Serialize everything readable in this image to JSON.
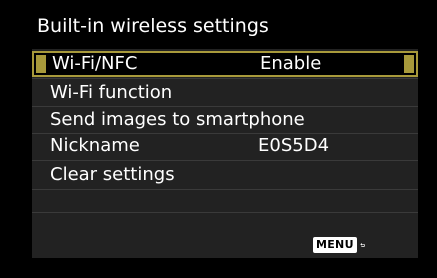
{
  "screen": {
    "title": "Built-in wireless settings"
  },
  "menu": {
    "items": [
      {
        "label": "Wi-Fi/NFC",
        "value": "Enable",
        "selected": true
      },
      {
        "label": "Wi-Fi function",
        "value": ""
      },
      {
        "label": "Send images to smartphone",
        "value": ""
      },
      {
        "label": "Nickname",
        "value": "E0S5D4"
      },
      {
        "label": "Clear settings",
        "value": ""
      }
    ]
  },
  "footer": {
    "menu_key_label": "MENU",
    "back_icon": "return-arrow-icon"
  },
  "colors": {
    "background": "#000000",
    "panel": "#222222",
    "highlight": "#a89a3b",
    "text": "#ffffff"
  }
}
